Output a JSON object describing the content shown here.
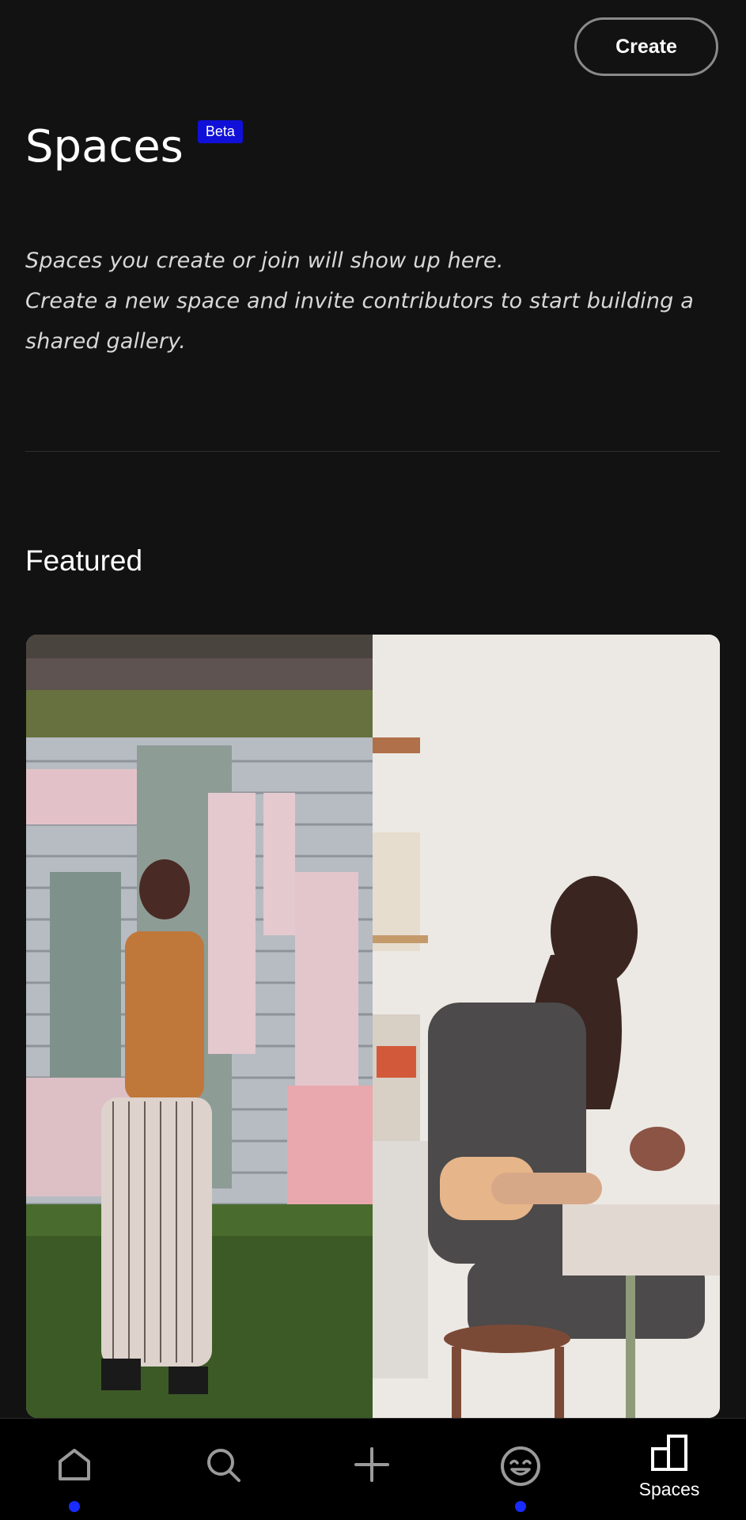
{
  "header": {
    "create_label": "Create",
    "title": "Spaces",
    "badge": "Beta"
  },
  "description": {
    "lines": [
      "Spaces you create or join will show up here.",
      "Create a new space and invite contributors to start building a",
      "shared gallery."
    ]
  },
  "featured": {
    "heading": "Featured"
  },
  "bottom_nav": {
    "items": [
      {
        "icon": "home-icon",
        "label": "",
        "has_dot": true
      },
      {
        "icon": "search-icon",
        "label": "",
        "has_dot": false
      },
      {
        "icon": "plus-icon",
        "label": "",
        "has_dot": false
      },
      {
        "icon": "smiley-icon",
        "label": "",
        "has_dot": true
      },
      {
        "icon": "spaces-icon",
        "label": "Spaces",
        "has_dot": false
      }
    ]
  },
  "colors": {
    "background": "#121212",
    "accent_dot": "#1a2bff",
    "badge": "#1010d8"
  }
}
